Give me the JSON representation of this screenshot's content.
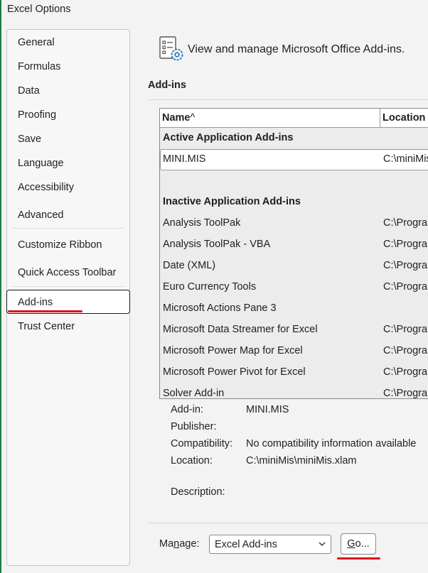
{
  "window": {
    "title": "Excel Options"
  },
  "sidebar": {
    "items": [
      {
        "label": "General"
      },
      {
        "label": "Formulas"
      },
      {
        "label": "Data"
      },
      {
        "label": "Proofing"
      },
      {
        "label": "Save"
      },
      {
        "label": "Language"
      },
      {
        "label": "Accessibility"
      },
      {
        "label": "Advanced"
      },
      {
        "label": "Customize Ribbon"
      },
      {
        "label": "Quick Access Toolbar"
      },
      {
        "label": "Add-ins",
        "selected": true
      },
      {
        "label": "Trust Center"
      }
    ]
  },
  "header": {
    "icon": "addins-settings-icon",
    "title": "View and manage Microsoft Office Add-ins."
  },
  "section": {
    "label": "Add-ins"
  },
  "table": {
    "columns": {
      "name": "Name",
      "sort_glyph": "^",
      "location": "Location"
    },
    "active_group": "Active Application Add-ins",
    "active_rows": [
      {
        "name": "MINI.MIS",
        "location": "C:\\miniMis"
      }
    ],
    "inactive_group": "Inactive Application Add-ins",
    "inactive_rows": [
      {
        "name": "Analysis ToolPak",
        "location": "C:\\Progra"
      },
      {
        "name": "Analysis ToolPak - VBA",
        "location": "C:\\Progra"
      },
      {
        "name": "Date (XML)",
        "location": "C:\\Progra"
      },
      {
        "name": "Euro Currency Tools",
        "location": "C:\\Progra"
      },
      {
        "name": "Microsoft Actions Pane 3",
        "location": ""
      },
      {
        "name": "Microsoft Data Streamer for Excel",
        "location": "C:\\Progra"
      },
      {
        "name": "Microsoft Power Map for Excel",
        "location": "C:\\Progra"
      },
      {
        "name": "Microsoft Power Pivot for Excel",
        "location": "C:\\Progra"
      },
      {
        "name": "Solver Add-in",
        "location": "C:\\Progra"
      }
    ]
  },
  "details": {
    "addin_label": "Add-in:",
    "addin_value": "MINI.MIS",
    "publisher_label": "Publisher:",
    "publisher_value": "",
    "compat_label": "Compatibility:",
    "compat_value": "No compatibility information available",
    "location_label": "Location:",
    "location_value": "C:\\miniMis\\miniMis.xlam",
    "description_label": "Description:",
    "description_value": ""
  },
  "manage": {
    "label_pre": "Ma",
    "label_access": "n",
    "label_post": "age:",
    "selected": "Excel Add-ins",
    "go_access": "G",
    "go_rest": "o..."
  },
  "colors": {
    "accent_green": "#1e7b45",
    "annotation_red": "#e0141e"
  }
}
